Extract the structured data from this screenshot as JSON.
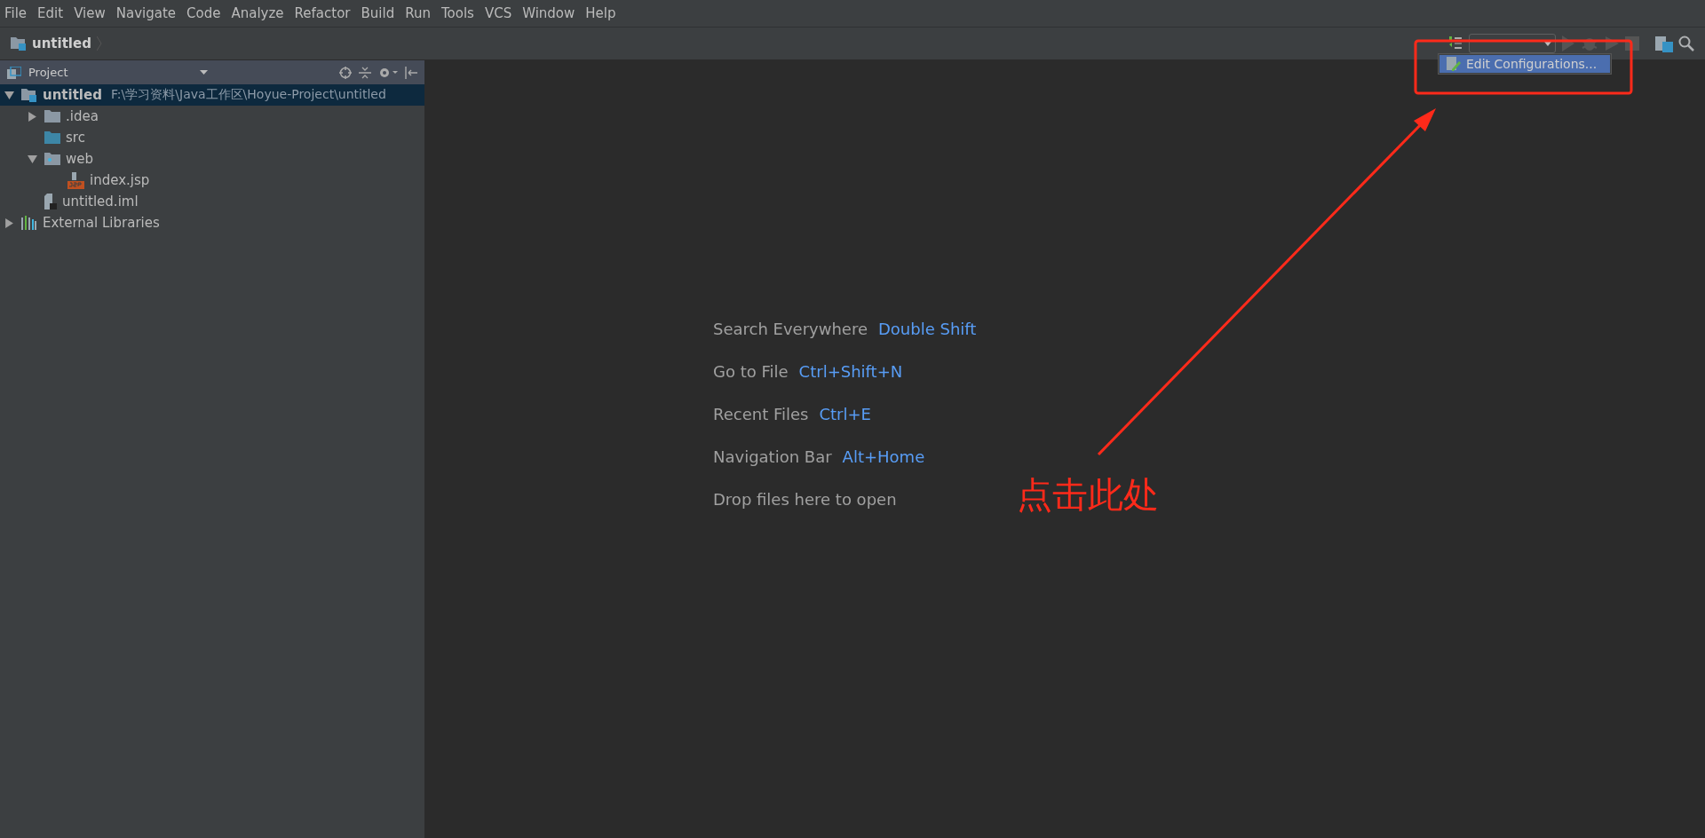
{
  "menu": [
    {
      "label": "File"
    },
    {
      "label": "Edit"
    },
    {
      "label": "View"
    },
    {
      "label": "Navigate"
    },
    {
      "label": "Code"
    },
    {
      "label": "Analyze"
    },
    {
      "label": "Refactor"
    },
    {
      "label": "Build"
    },
    {
      "label": "Run"
    },
    {
      "label": "Tools"
    },
    {
      "label": "VCS"
    },
    {
      "label": "Window"
    },
    {
      "label": "Help"
    }
  ],
  "nav": {
    "crumb": "untitled"
  },
  "project_panel": {
    "title": "Project"
  },
  "tree": [
    {
      "label": "untitled",
      "path": "F:\\学习资料\\Java工作区\\Hoyue-Project\\untitled",
      "kind": "module",
      "selected": true,
      "expanded": true,
      "children": [
        {
          "label": ".idea",
          "kind": "folder",
          "selected": false,
          "expanded": false
        },
        {
          "label": "src",
          "kind": "source-folder",
          "selected": false
        },
        {
          "label": "web",
          "kind": "web-folder",
          "selected": false,
          "expanded": true,
          "children": [
            {
              "label": "index.jsp",
              "kind": "jsp",
              "selected": false
            }
          ]
        },
        {
          "label": "untitled.iml",
          "kind": "iml",
          "selected": false
        }
      ]
    },
    {
      "label": "External Libraries",
      "kind": "libraries",
      "selected": false,
      "expanded": false
    }
  ],
  "run_menu": {
    "items": [
      {
        "label": "Edit Configurations...",
        "selected": true
      }
    ]
  },
  "hints": [
    {
      "text": "Search Everywhere",
      "shortcut": "Double Shift"
    },
    {
      "text": "Go to File",
      "shortcut": "Ctrl+Shift+N"
    },
    {
      "text": "Recent Files",
      "shortcut": "Ctrl+E"
    },
    {
      "text": "Navigation Bar",
      "shortcut": "Alt+Home"
    },
    {
      "text": "Drop files here to open"
    }
  ],
  "annotation": {
    "text": "点击此处"
  }
}
